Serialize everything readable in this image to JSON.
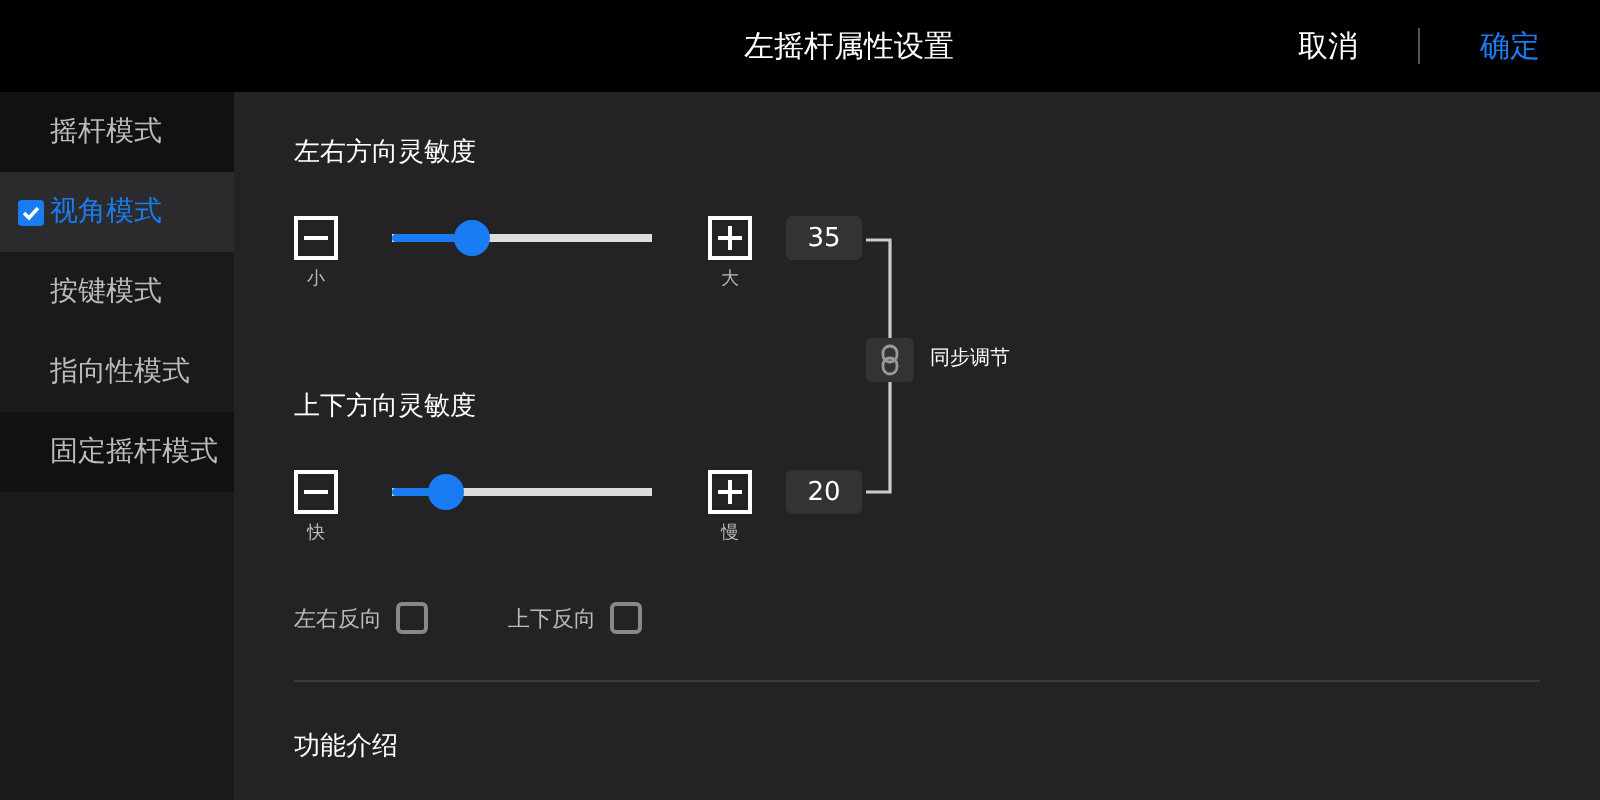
{
  "header": {
    "title": "左摇杆属性设置",
    "cancel": "取消",
    "confirm": "确定"
  },
  "modes": [
    {
      "label": "摇杆模式",
      "selected": false
    },
    {
      "label": "视角模式",
      "selected": true
    },
    {
      "label": "按键模式",
      "selected": false
    },
    {
      "label": "指向性模式",
      "selected": false
    },
    {
      "label": "固定摇杆模式",
      "selected": false
    }
  ],
  "sensitivity": [
    {
      "title": "左右方向灵敏度",
      "level": 0.31,
      "value": "35",
      "min_label": "小",
      "max_label": "大"
    },
    {
      "title": "上下方向灵敏度",
      "level": 0.21,
      "value": "20",
      "min_label": "快",
      "max_label": "慢"
    }
  ],
  "sync": {
    "label": "同步调节"
  },
  "reverse": [
    {
      "label": "左右反向",
      "checked": false
    },
    {
      "label": "上下反向",
      "checked": false
    }
  ],
  "section_title": "功能介绍"
}
